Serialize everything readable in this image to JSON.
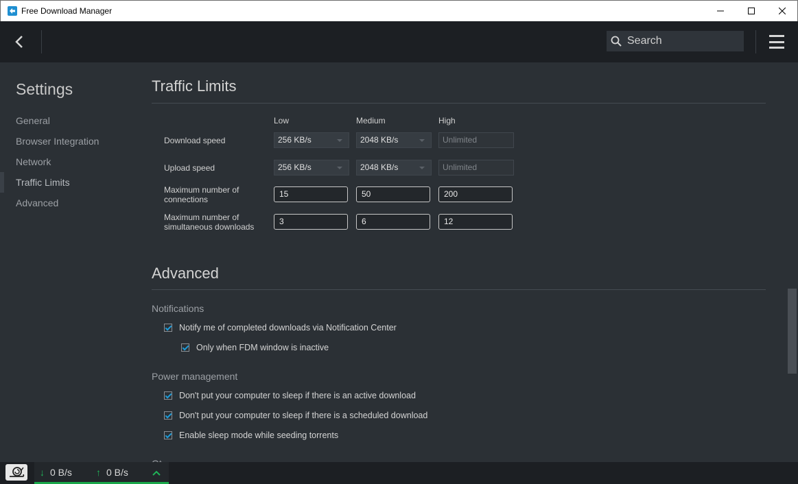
{
  "window": {
    "title": "Free Download Manager",
    "minimize_icon": "minimize-icon",
    "maximize_icon": "maximize-icon",
    "close_icon": "close-icon"
  },
  "toolbar": {
    "search_placeholder": "Search"
  },
  "sidebar": {
    "title": "Settings",
    "items": [
      {
        "label": "General"
      },
      {
        "label": "Browser Integration"
      },
      {
        "label": "Network"
      },
      {
        "label": "Traffic Limits",
        "active": true
      },
      {
        "label": "Advanced"
      }
    ]
  },
  "traffic_limits": {
    "title": "Traffic Limits",
    "columns": [
      "Low",
      "Medium",
      "High"
    ],
    "download_speed": {
      "label": "Download speed",
      "low": "256 KB/s",
      "medium": "2048 KB/s",
      "high": "Unlimited"
    },
    "upload_speed": {
      "label": "Upload speed",
      "low": "256 KB/s",
      "medium": "2048 KB/s",
      "high": "Unlimited"
    },
    "max_connections": {
      "label_line1": "Maximum number of",
      "label_line2": "connections",
      "low": "15",
      "medium": "50",
      "high": "200"
    },
    "max_downloads": {
      "label_line1": "Maximum number of",
      "label_line2": "simultaneous downloads",
      "low": "3",
      "medium": "6",
      "high": "12"
    }
  },
  "advanced": {
    "title": "Advanced",
    "notifications": {
      "label": "Notifications",
      "notify_completed": "Notify me of completed downloads via Notification Center",
      "only_inactive": "Only when FDM window is inactive"
    },
    "power": {
      "label": "Power management",
      "no_sleep_active": "Don't put your computer to sleep if there is an active download",
      "no_sleep_scheduled": "Don't put your computer to sleep if there is a scheduled download",
      "sleep_seeding": "Enable sleep mode while seeding torrents"
    },
    "next_section_partial": "Ot"
  },
  "statusbar": {
    "download_speed": "0 B/s",
    "upload_speed": "0 B/s"
  },
  "colors": {
    "accent": "#1e9bd7",
    "status_green": "#1aa84a"
  }
}
